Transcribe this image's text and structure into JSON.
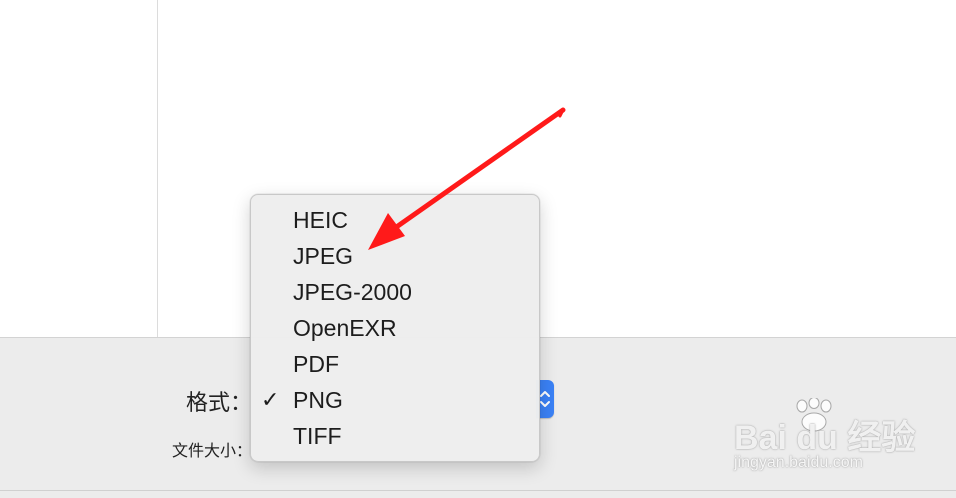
{
  "export_panel": {
    "format_label": "格式：",
    "file_size_label": "文件大小：",
    "format_popup": {
      "selected": "PNG"
    }
  },
  "format_menu": {
    "items": [
      {
        "label": "HEIC",
        "checked": false
      },
      {
        "label": "JPEG",
        "checked": false
      },
      {
        "label": "JPEG-2000",
        "checked": false
      },
      {
        "label": "OpenEXR",
        "checked": false
      },
      {
        "label": "PDF",
        "checked": false
      },
      {
        "label": "PNG",
        "checked": true
      },
      {
        "label": "TIFF",
        "checked": false
      }
    ],
    "checkmark": "✓"
  },
  "annotation": {
    "arrow_color": "#ff1a1a",
    "arrow_icon": "red-arrow-icon"
  },
  "watermark": {
    "brand": "Bai du 经验",
    "url": "jingyan.baidu.com"
  },
  "colors": {
    "accent": "#3b82f6",
    "panel": "#ececec"
  }
}
